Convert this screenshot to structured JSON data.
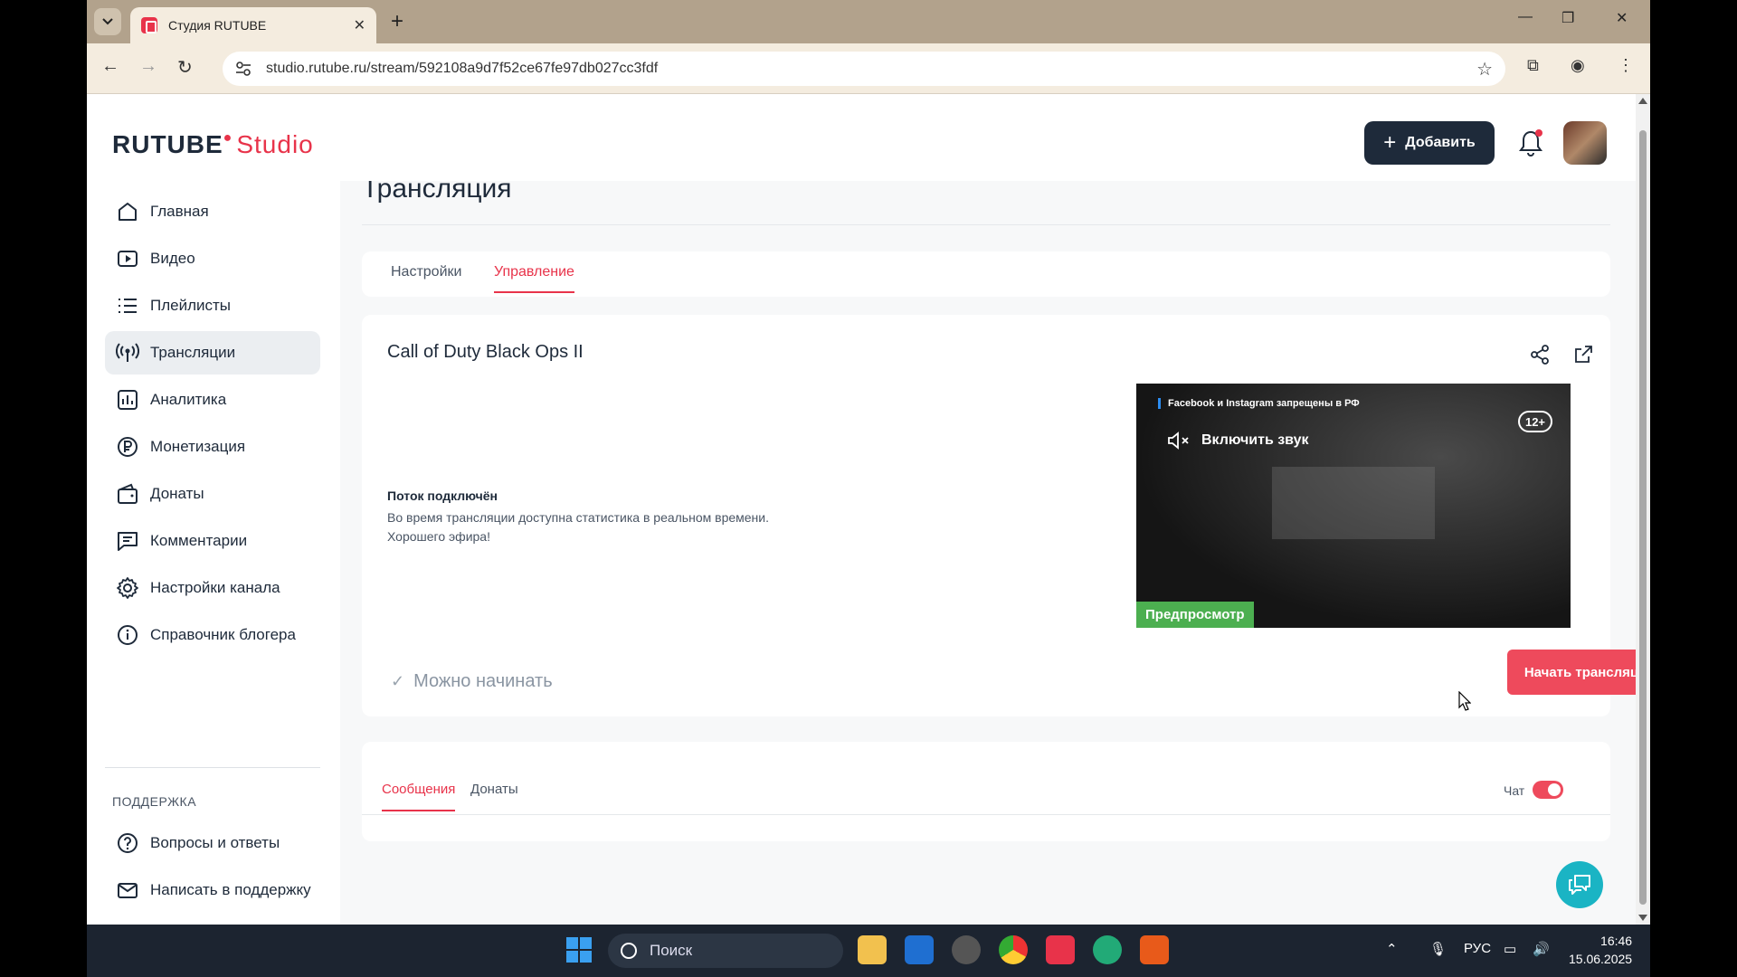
{
  "browser": {
    "tab_title": "Студия RUTUBE",
    "url": "studio.rutube.ru/stream/592108a9d7f52ce67fe97db027cc3fdf"
  },
  "header": {
    "logo_main": "RUTUBE",
    "logo_sub": "Studio",
    "add_label": "Добавить"
  },
  "sidebar": {
    "items": [
      {
        "label": "Главная",
        "icon": "home-icon"
      },
      {
        "label": "Видео",
        "icon": "video-icon"
      },
      {
        "label": "Плейлисты",
        "icon": "playlist-icon"
      },
      {
        "label": "Трансляции",
        "icon": "broadcast-icon",
        "active": true
      },
      {
        "label": "Аналитика",
        "icon": "analytics-icon"
      },
      {
        "label": "Монетизация",
        "icon": "ruble-icon"
      },
      {
        "label": "Донаты",
        "icon": "wallet-icon"
      },
      {
        "label": "Комментарии",
        "icon": "comment-icon"
      },
      {
        "label": "Настройки канала",
        "icon": "gear-icon"
      },
      {
        "label": "Справочник блогера",
        "icon": "info-icon"
      }
    ],
    "support_title": "ПОДДЕРЖКА",
    "support_items": [
      {
        "label": "Вопросы и ответы",
        "icon": "question-icon"
      },
      {
        "label": "Написать в поддержку",
        "icon": "mail-icon"
      }
    ]
  },
  "main": {
    "page_title": "Трансляция",
    "tabs": [
      {
        "label": "Настройки",
        "active": false
      },
      {
        "label": "Управление",
        "active": true
      }
    ],
    "stream": {
      "title": "Call of Duty Black Ops II",
      "status_head": "Поток подключён",
      "status_line1": "Во время трансляции доступна статистика в реальном времени.",
      "status_line2": "Хорошего эфира!",
      "ready": "Можно начинать",
      "start_button": "Начать трансляцию"
    },
    "preview": {
      "notice": "Facebook и Instagram запрещены в РФ",
      "age": "12+",
      "unmute": "Включить звук",
      "badge": "Предпросмотр"
    },
    "chat": {
      "tabs": [
        {
          "label": "Сообщения",
          "active": true
        },
        {
          "label": "Донаты",
          "active": false
        }
      ],
      "chat_label": "Чат",
      "chat_enabled": true
    }
  },
  "taskbar": {
    "search": "Поиск",
    "lang": "РУС",
    "time": "16:46",
    "date": "15.06.2025"
  },
  "colors": {
    "accent": "#e8334a",
    "dark": "#1e2a3a",
    "preview_badge": "#4caf50",
    "help_fab": "#1ab4c4"
  }
}
